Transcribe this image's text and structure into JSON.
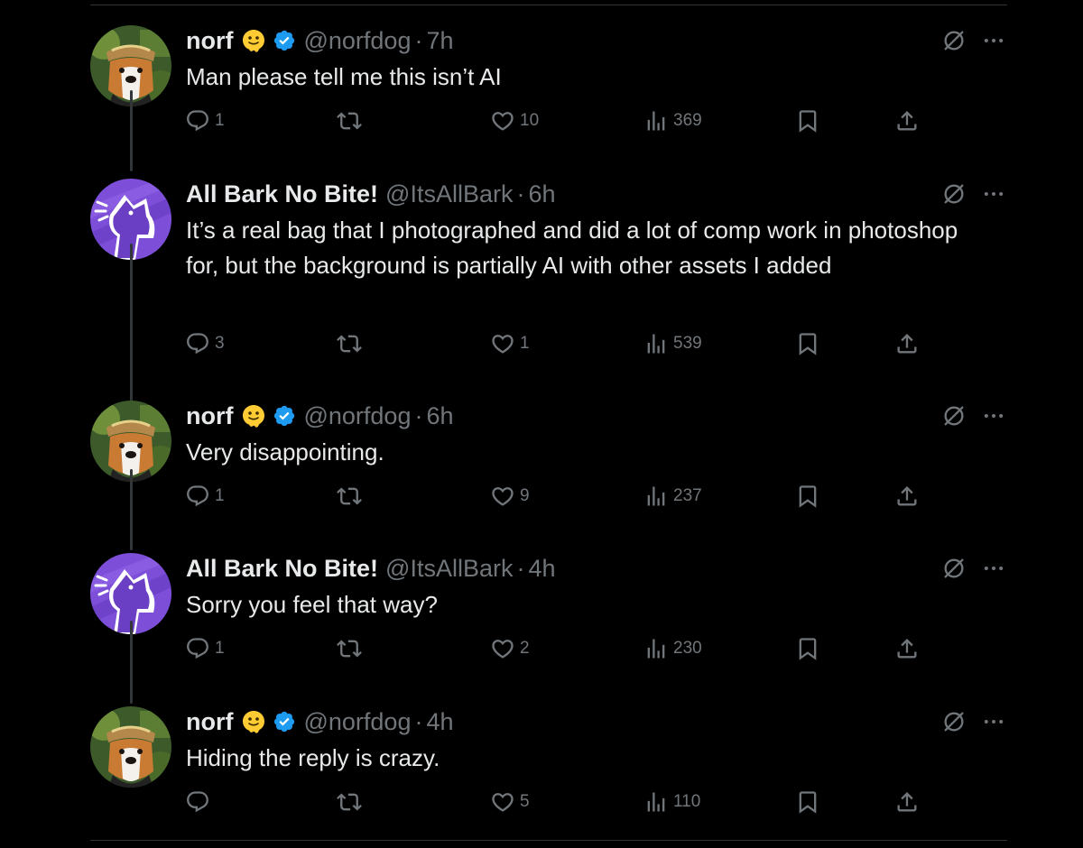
{
  "tweets": [
    {
      "author": "norf",
      "has_emoji": true,
      "verified": true,
      "handle": "@norfdog",
      "time": "7h",
      "text": "Man please tell me this isn’t AI",
      "replies": "1",
      "retweets": "",
      "likes": "10",
      "views": "369",
      "avatar": "dog-avatar"
    },
    {
      "author": "All Bark No Bite!",
      "has_emoji": false,
      "verified": false,
      "handle": "@ItsAllBark",
      "time": "6h",
      "text": "It’s a real bag that I photographed and did a lot of comp work in photoshop for, but the background is partially AI with other assets I added",
      "replies": "3",
      "retweets": "",
      "likes": "1",
      "views": "539",
      "avatar": "howling-wolf-avatar"
    },
    {
      "author": "norf",
      "has_emoji": true,
      "verified": true,
      "handle": "@norfdog",
      "time": "6h",
      "text": "Very disappointing.",
      "replies": "1",
      "retweets": "",
      "likes": "9",
      "views": "237",
      "avatar": "dog-avatar"
    },
    {
      "author": "All Bark No Bite!",
      "has_emoji": false,
      "verified": false,
      "handle": "@ItsAllBark",
      "time": "4h",
      "text": "Sorry you feel that way?",
      "replies": "1",
      "retweets": "",
      "likes": "2",
      "views": "230",
      "avatar": "howling-wolf-avatar"
    },
    {
      "author": "norf",
      "has_emoji": true,
      "verified": true,
      "handle": "@norfdog",
      "time": "4h",
      "text": "Hiding the reply is crazy.",
      "replies": "",
      "retweets": "",
      "likes": "5",
      "views": "110",
      "avatar": "dog-avatar"
    }
  ],
  "separator": "·",
  "colors": {
    "background": "#000000",
    "text": "#e7e9ea",
    "muted": "#71767b",
    "verified": "#1d9bf0",
    "wolf_purple": "#7d4fd9",
    "emoji_yellow": "#ffcc33"
  }
}
